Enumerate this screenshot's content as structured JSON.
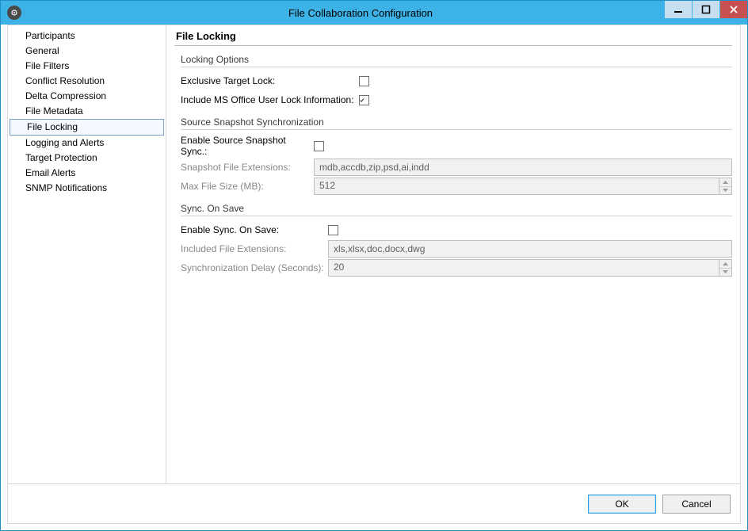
{
  "window": {
    "title": "File Collaboration Configuration"
  },
  "sidebar": {
    "items": [
      {
        "label": "Participants"
      },
      {
        "label": "General"
      },
      {
        "label": "File Filters"
      },
      {
        "label": "Conflict Resolution"
      },
      {
        "label": "Delta Compression"
      },
      {
        "label": "File Metadata"
      },
      {
        "label": "File Locking",
        "selected": true
      },
      {
        "label": "Logging and Alerts"
      },
      {
        "label": "Target Protection"
      },
      {
        "label": "Email Alerts"
      },
      {
        "label": "SNMP Notifications"
      }
    ]
  },
  "page": {
    "heading": "File Locking",
    "locking": {
      "title": "Locking Options",
      "exclusive_label": "Exclusive Target Lock:",
      "exclusive_checked": false,
      "msoffice_label": "Include MS Office User Lock Information:",
      "msoffice_checked": true
    },
    "snapshot": {
      "title": "Source Snapshot Synchronization",
      "enable_label": "Enable Source Snapshot Sync.:",
      "enable_checked": false,
      "ext_label": "Snapshot File Extensions:",
      "ext_value": "mdb,accdb,zip,psd,ai,indd",
      "max_label": "Max File Size (MB):",
      "max_value": "512"
    },
    "syncsave": {
      "title": "Sync. On Save",
      "enable_label": "Enable Sync. On Save:",
      "enable_checked": false,
      "ext_label": "Included File Extensions:",
      "ext_value": "xls,xlsx,doc,docx,dwg",
      "delay_label": "Synchronization Delay (Seconds):",
      "delay_value": "20"
    }
  },
  "buttons": {
    "ok": "OK",
    "cancel": "Cancel"
  }
}
